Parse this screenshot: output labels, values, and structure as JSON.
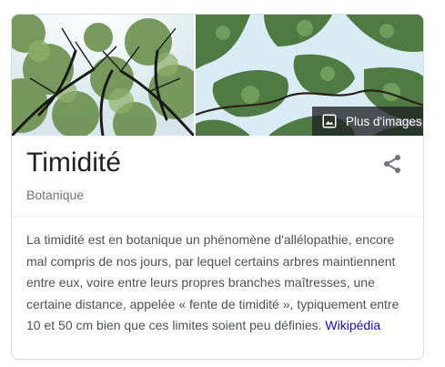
{
  "knowledge_panel": {
    "more_images_label": "Plus d'images",
    "title": "Timidité",
    "subtitle": "Botanique",
    "description": "La timidité est en botanique un phénomène d'allélopathie, encore mal compris de nos jours, par lequel certains arbres maintiennent entre eux, voire entre leurs propres branches maîtresses, une certaine distance, appelée « fente de timidité », typiquement entre 10 et 50 cm bien que ces limites soient peu définies.",
    "source_link": "Wikipédia",
    "icons": {
      "image": "image-icon",
      "share": "share-icon"
    },
    "colors": {
      "title": "#202124",
      "subtitle": "#70757a",
      "body_text": "#4d5156",
      "link": "#1a0dab",
      "border": "#dadce0",
      "sky": "#d9ecf4",
      "foliage": "#4f7a43"
    }
  }
}
